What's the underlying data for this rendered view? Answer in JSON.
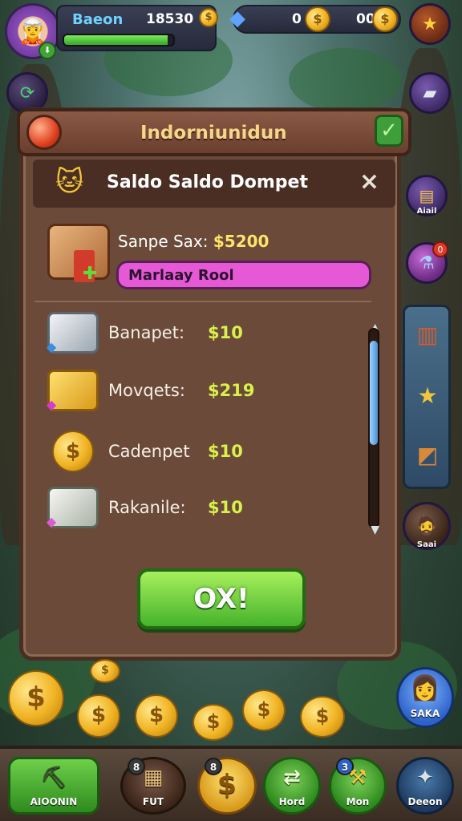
{
  "hud": {
    "player_name": "Baeon",
    "coins": "18530",
    "gem_left": "0",
    "gem_right": "00",
    "xp_progress": 0.95
  },
  "side_left": {
    "top_btn_icon": "swap-icon"
  },
  "side_right": {
    "btn1_icon": "star-chest-icon",
    "btn2_icon": "silver-ingot-icon",
    "btn3_label": "Aiail",
    "btn4_badge": "0",
    "btn5_label": "Saai"
  },
  "dialog": {
    "header_title": "Indorniunidun",
    "subtitle": "Saldo Saldo Dompet",
    "close_label": "×",
    "featured_label": "Sanpe Sax:",
    "featured_amount": "$5200",
    "progress_label": "Marlaay Rool",
    "rows": [
      {
        "label": "Banapet:",
        "value": "$10",
        "icon": "silver-bars-icon"
      },
      {
        "label": "Movqets:",
        "value": "$219",
        "icon": "gold-bars-icon"
      },
      {
        "label": "Cadenpet",
        "value": "$10",
        "icon": "gold-coin-icon"
      },
      {
        "label": "Rakanile:",
        "value": "$10",
        "icon": "cash-stack-icon"
      }
    ],
    "ok_label": "OX!"
  },
  "saka": {
    "label": "SAKA"
  },
  "bottom_bar": {
    "items": [
      {
        "label": "AIOONIN",
        "badge": "",
        "icon": "pickaxe-icon"
      },
      {
        "label": "FUT",
        "badge": "8",
        "icon": "map-icon"
      },
      {
        "label": "",
        "badge": "8",
        "icon": "coin-icon"
      },
      {
        "label": "Hord",
        "badge": "",
        "icon": "arrow-swap-icon"
      },
      {
        "label": "Mon",
        "badge": "3",
        "icon": "hammer-icon"
      },
      {
        "label": "Deeon",
        "badge": "",
        "icon": "compass-icon"
      }
    ]
  },
  "colors": {
    "accent_green": "#46b32b",
    "progress_pink": "#e659d6",
    "value_yellow": "#d8f24a",
    "dialog_brown": "#6b4a3a"
  }
}
